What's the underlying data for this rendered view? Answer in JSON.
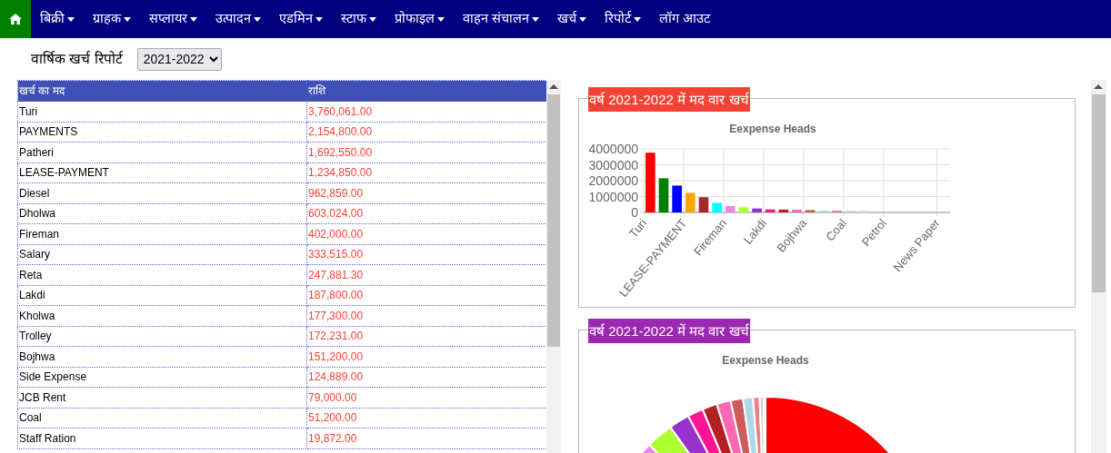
{
  "navbar": {
    "home": {
      "selected": true
    },
    "items": [
      {
        "label": "बिक्री",
        "has_menu": true
      },
      {
        "label": "ग्राहक",
        "has_menu": true
      },
      {
        "label": "सप्लायर",
        "has_menu": true
      },
      {
        "label": "उत्पादन",
        "has_menu": true
      },
      {
        "label": "एडमिन",
        "has_menu": true
      },
      {
        "label": "स्टाफ",
        "has_menu": true
      },
      {
        "label": "प्रोफाइल",
        "has_menu": true
      },
      {
        "label": "वाहन संचालन",
        "has_menu": true
      },
      {
        "label": "खर्च",
        "has_menu": true
      },
      {
        "label": "रिपोर्ट",
        "has_menu": true
      },
      {
        "label": "लॉग आउट",
        "has_menu": false
      }
    ]
  },
  "report": {
    "title": "वार्षिक खर्च रिपोर्ट",
    "year_select": "2021-2022"
  },
  "table": {
    "columns": [
      "खर्च का मद",
      "राशि"
    ],
    "rows": [
      [
        "Turi",
        "3,760,061.00"
      ],
      [
        "PAYMENTS",
        "2,154,800.00"
      ],
      [
        "Patheri",
        "1,692,550.00"
      ],
      [
        "LEASE-PAYMENT",
        "1,234,850.00"
      ],
      [
        "Diesel",
        "962,859.00"
      ],
      [
        "Dholwa",
        "603,024.00"
      ],
      [
        "Fireman",
        "402,000.00"
      ],
      [
        "Salary",
        "333,515.00"
      ],
      [
        "Reta",
        "247,881.30"
      ],
      [
        "Lakdi",
        "187,800.00"
      ],
      [
        "Kholwa",
        "177,300.00"
      ],
      [
        "Trolley",
        "172,231.00"
      ],
      [
        "Bojhwa",
        "151,200.00"
      ],
      [
        "Side Expense",
        "124,889.00"
      ],
      [
        "JCB Rent",
        "79,000.00"
      ],
      [
        "Coal",
        "51,200.00"
      ],
      [
        "Staff Ration",
        "19,872.00"
      ]
    ]
  },
  "panels": [
    {
      "legend": "वर्ष 2021-2022 में मद वार खर्च",
      "color": "#f44336",
      "kind": "bar",
      "chart_data": {
        "type": "bar",
        "title": "Eexpense Heads",
        "categories": [
          "Turi",
          null,
          null,
          "LEASE-PAYMENT",
          null,
          null,
          "Fireman",
          null,
          null,
          "Lakdi",
          null,
          null,
          "Bojhwa",
          null,
          null,
          "Coal",
          null,
          null,
          "Petrol",
          null,
          null,
          null,
          "News Paper"
        ],
        "values": [
          3760000,
          2150000,
          1690000,
          1230000,
          960000,
          600000,
          400000,
          330000,
          250000,
          190000,
          180000,
          170000,
          150000,
          120000,
          80000,
          50000,
          20000,
          null,
          null,
          null,
          null,
          null,
          null
        ],
        "colors": [
          "#ff0000",
          "#008000",
          "#0000ff",
          "#ffa500",
          "#a52a2a",
          "#00ffff",
          "#ee82ee",
          "#adff2f",
          "#9932cc",
          "#ff1493",
          "#b22222",
          "#ff69b4",
          "#cd5c5c",
          "#add8e6",
          "#f08080",
          "#d3d3d3",
          "#dddddd",
          null,
          null,
          null,
          null,
          null,
          null
        ],
        "grid": true,
        "ylim": [
          0,
          4000000
        ],
        "yticks": [
          0,
          1000000,
          2000000,
          3000000,
          4000000
        ]
      }
    },
    {
      "legend": "वर्ष 2021-2022 में मद वार खर्च",
      "color": "#9c27b0",
      "kind": "pie",
      "chart_title": "Eexpense Heads"
    }
  ]
}
